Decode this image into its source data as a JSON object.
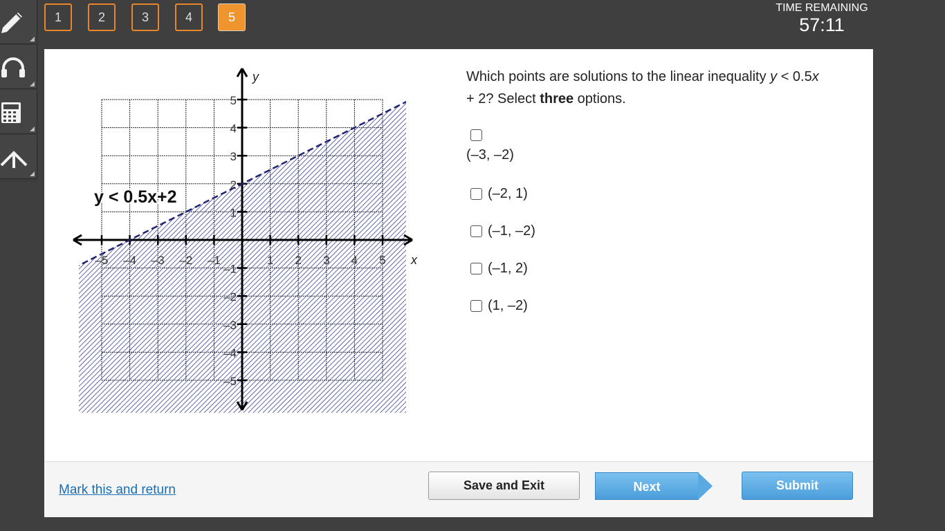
{
  "toolbar": {
    "tools": [
      {
        "icon": "pencil-icon"
      },
      {
        "icon": "headphones-icon"
      },
      {
        "icon": "calculator-icon"
      },
      {
        "icon": "reference-icon"
      }
    ]
  },
  "nav": {
    "questions": [
      "1",
      "2",
      "3",
      "4",
      "5"
    ],
    "active": "5"
  },
  "timer": {
    "label": "TIME REMAINING",
    "value": "57:11"
  },
  "graph": {
    "inequality_label": "y < 0.5x+2",
    "x_axis_label": "x",
    "y_axis_label": "y",
    "x_ticks": [
      "–5",
      "–4",
      "–3",
      "–2",
      "–1",
      "1",
      "2",
      "3",
      "4",
      "5"
    ],
    "y_ticks": [
      "5",
      "4",
      "3",
      "2",
      "1",
      "–1",
      "–2",
      "–3",
      "–4",
      "–5"
    ],
    "line": {
      "slope": 0.5,
      "intercept": 2,
      "style": "dashed"
    },
    "shading": "below",
    "shade_color": "#3a3f8f",
    "line_color": "#1f2470"
  },
  "question": {
    "text_part1": "Which points are solutions to the linear inequality ",
    "var_y": "y",
    "text_part2": " < 0.5",
    "var_x": "x",
    "text_part3": " + 2? Select ",
    "bold": "three",
    "text_part4": " options."
  },
  "options": [
    "(–3, –2)",
    "(–2, 1)",
    "(–1, –2)",
    "(–1, 2)",
    "(1, –2)"
  ],
  "footer": {
    "mark_link": "Mark this and return",
    "save_exit": "Save and Exit",
    "next": "Next",
    "submit": "Submit"
  },
  "colors": {
    "accent_orange": "#f0952e",
    "button_blue": "#4a9edb",
    "link_blue": "#1a6eb2"
  }
}
